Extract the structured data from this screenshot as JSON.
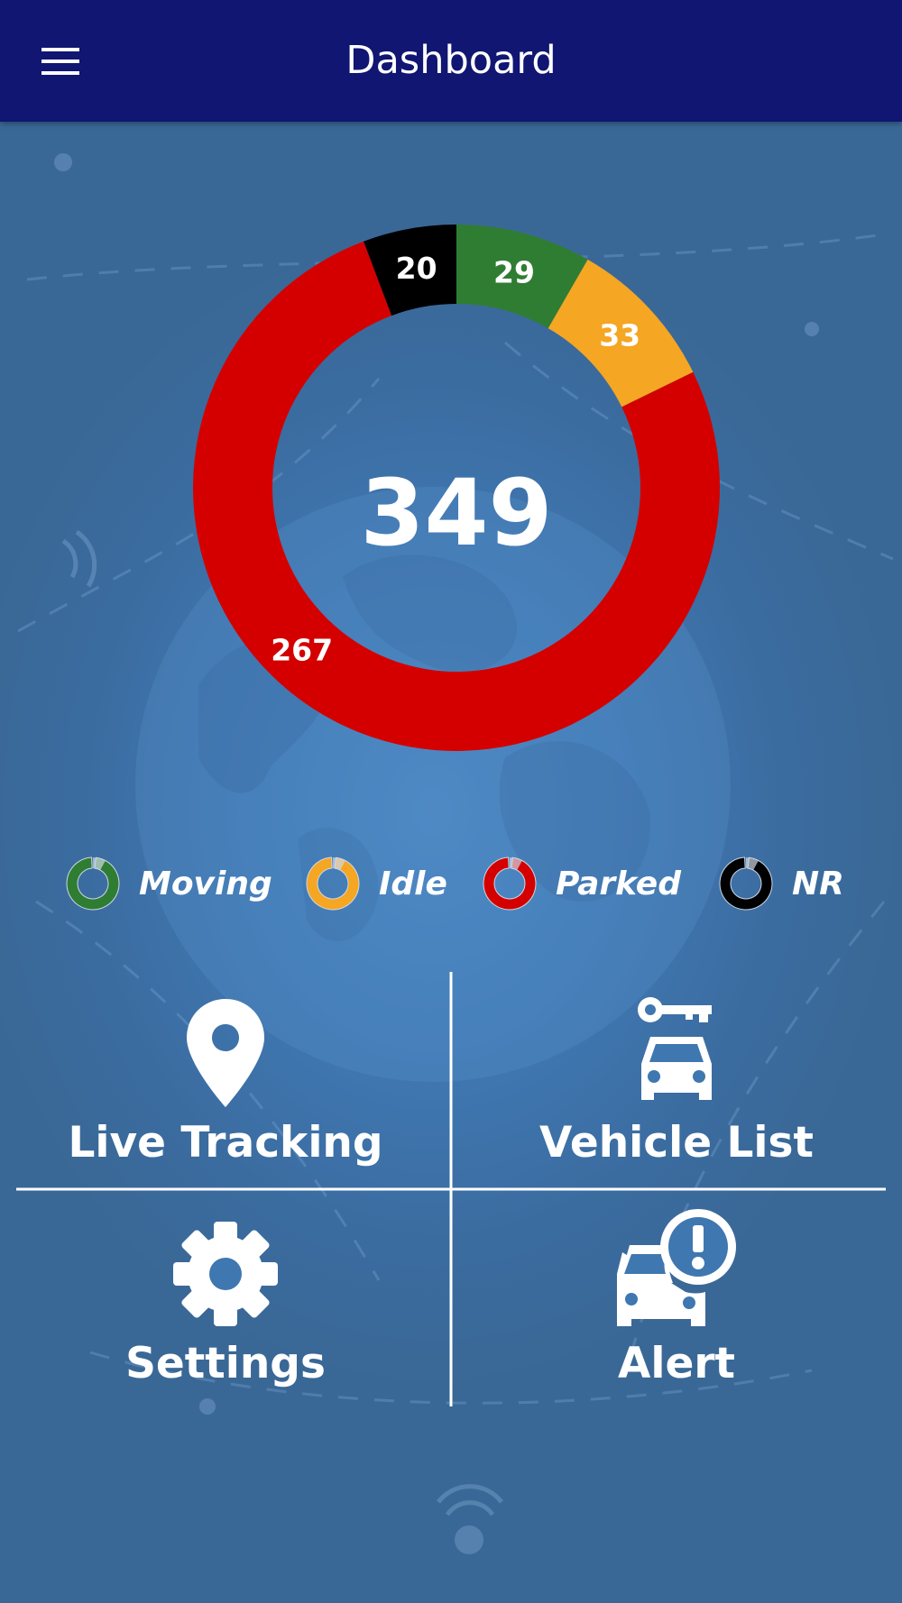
{
  "app_bar": {
    "title": "Dashboard",
    "menu_icon": "hamburger-menu-icon",
    "background": "#101672"
  },
  "chart_data": {
    "type": "pie",
    "variant": "donut",
    "total": "349",
    "series": [
      {
        "name": "Moving",
        "value": 29,
        "color": "#2f7d32"
      },
      {
        "name": "Idle",
        "value": 33,
        "color": "#f5a623"
      },
      {
        "name": "Parked",
        "value": 267,
        "color": "#d40000"
      },
      {
        "name": "NR",
        "value": 20,
        "color": "#000000"
      }
    ],
    "legend_placement": "below"
  },
  "legend": {
    "items": [
      {
        "label": "Moving",
        "color": "#2f7d32"
      },
      {
        "label": "Idle",
        "color": "#f5a623"
      },
      {
        "label": "Parked",
        "color": "#d40000"
      },
      {
        "label": "NR",
        "color": "#000000"
      }
    ]
  },
  "tiles": {
    "live_tracking": {
      "label": "Live Tracking",
      "icon": "map-pin-icon"
    },
    "vehicle_list": {
      "label": "Vehicle List",
      "icon": "car-key-icon"
    },
    "settings": {
      "label": "Settings",
      "icon": "gear-icon"
    },
    "alert": {
      "label": "Alert",
      "icon": "car-alert-icon"
    }
  }
}
